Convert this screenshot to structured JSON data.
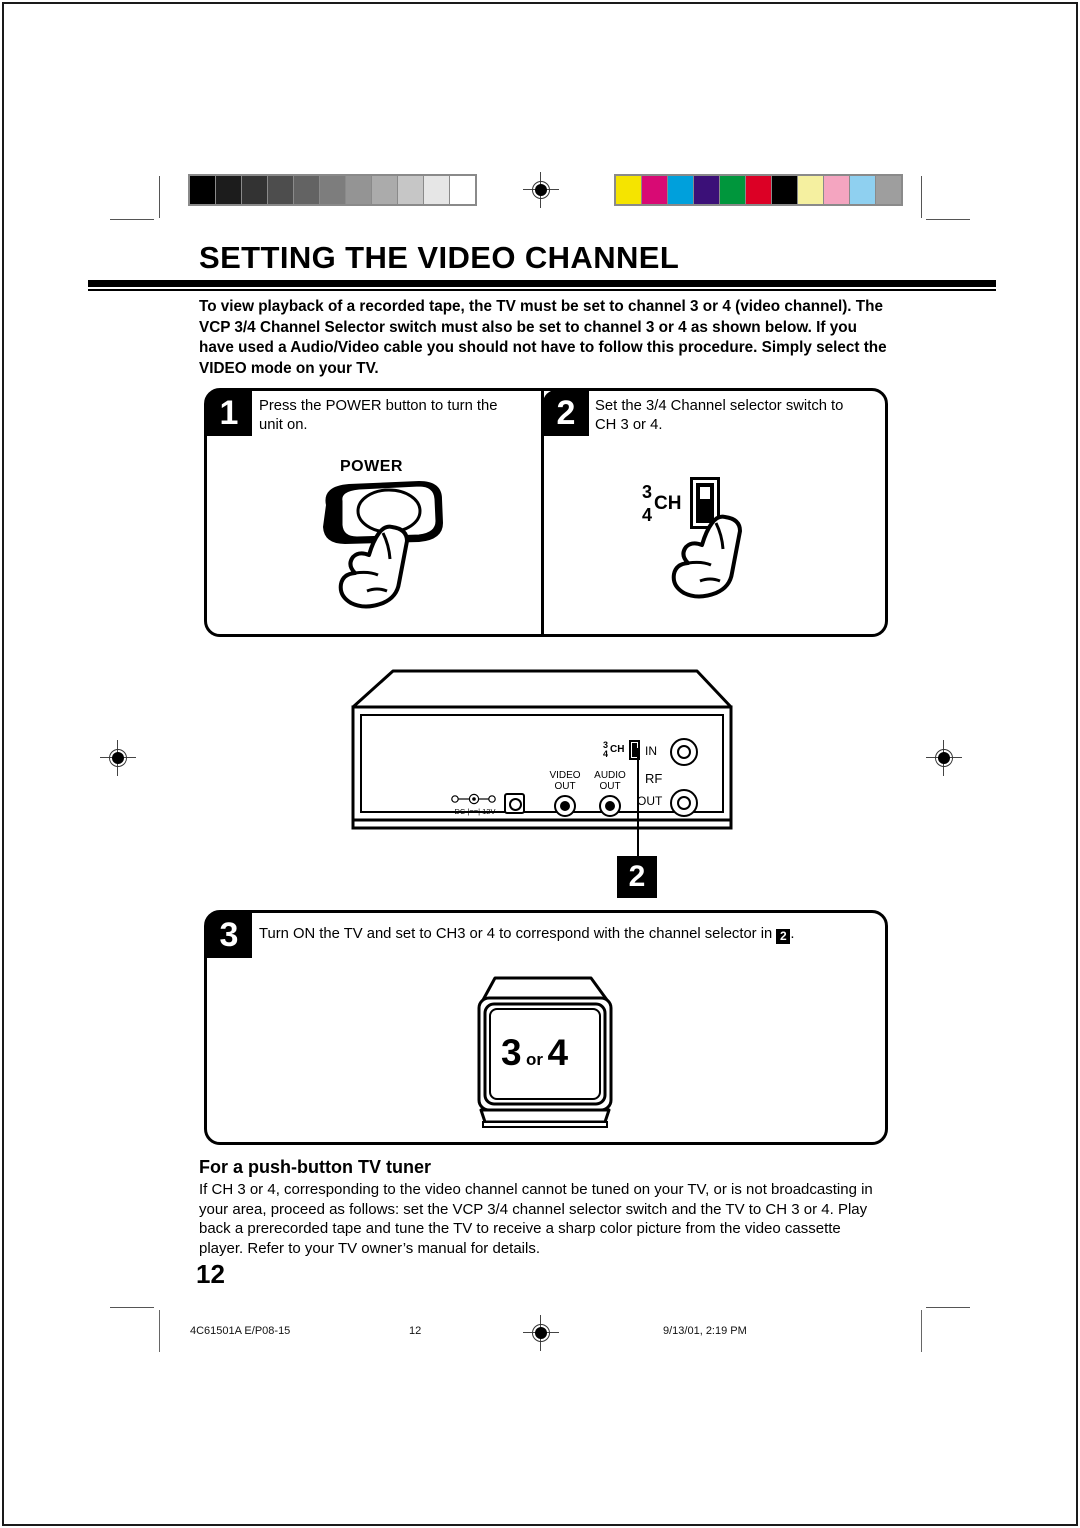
{
  "document": {
    "heading": "SETTING THE VIDEO CHANNEL",
    "intro": "To view playback of a recorded tape, the TV must be set to channel 3 or 4 (video channel). The VCP 3/4 Channel Selector switch must also be set to channel 3 or 4 as shown below. If you have used a Audio/Video cable you should not have to follow this procedure. Simply select the VIDEO mode on your TV.",
    "page_number": "12"
  },
  "steps": [
    {
      "number": "1",
      "text": "Press the POWER button to turn the unit on.",
      "button_label": "POWER"
    },
    {
      "number": "2",
      "text": "Set the 3/4 Channel selector switch to CH 3 or 4.",
      "switch": {
        "top_channel": "3",
        "bottom_channel": "4",
        "label": "CH"
      }
    },
    {
      "number": "3",
      "text_before": "Turn ON the TV and set to CH3 or 4 to correspond with the channel selector in",
      "inline_badge": "2",
      "text_after": ".",
      "tv_screen": {
        "channel_a": "3",
        "conjunction": "or",
        "channel_b": "4"
      }
    }
  ],
  "rear_panel": {
    "callout_badge": "2",
    "selector": {
      "top_channel": "3",
      "bottom_channel": "4",
      "label": "CH"
    },
    "dc_jack": {
      "label": "DC |==| 12V"
    },
    "jacks": [
      {
        "name": "video-out",
        "line1": "VIDEO",
        "line2": "OUT"
      },
      {
        "name": "audio-out",
        "line1": "AUDIO",
        "line2": "OUT"
      }
    ],
    "rf": {
      "group_label": "RF",
      "in_label": "IN",
      "out_label": "OUT"
    }
  },
  "bottom_section": {
    "sub_heading": "For a push-button TV tuner",
    "body": "If CH 3 or 4, corresponding to the video channel cannot be tuned on your TV, or is not broadcasting in your area, proceed as follows: set the VCP 3/4 channel selector switch and the TV to CH 3 or 4. Play back a prerecorded tape and tune the TV to receive a sharp color picture from the video cassette player. Refer to your TV owner’s manual for details."
  },
  "footer": {
    "doc_code": "4C61501A E/P08-15",
    "page": "12",
    "timestamp": "9/13/01, 2:19 PM"
  },
  "calibration": {
    "grayscale": [
      "#000000",
      "#1c1c1c",
      "#333333",
      "#4d4d4d",
      "#636363",
      "#7d7d7d",
      "#949494",
      "#ababab",
      "#c6c6c6",
      "#e6e6e6",
      "#ffffff"
    ],
    "colors": [
      "#f5e400",
      "#d80a74",
      "#00a0dc",
      "#3b1078",
      "#00963c",
      "#dc0025",
      "#000000",
      "#f5f0a0",
      "#f4a5c0",
      "#8fd0f0",
      "#9e9e9e"
    ]
  }
}
